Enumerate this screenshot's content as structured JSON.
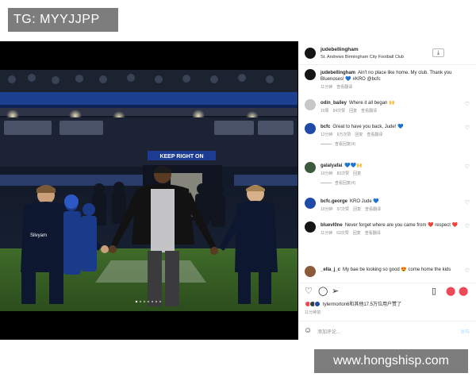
{
  "tag": {
    "text": "TG: MYYJJPP"
  },
  "header": {
    "username": "judebellingham",
    "location": "St. Andrews Birmingham City Football Club",
    "more_icon": "download-box-icon"
  },
  "comments": [
    {
      "user": "judebellingham",
      "text": "Ain't no place like home. My club. Thank you Bluenoses! 💙 #KRO @bcfc",
      "time": "11分钟",
      "translate": "查看翻译",
      "likes": "",
      "reply": "",
      "avatar_color": "#2a2a2a"
    },
    {
      "user": "odin_bailey",
      "text": "Where it all began 🙌",
      "time": "10周",
      "likes": "84次赞",
      "reply": "回复",
      "translate": "查看翻译",
      "avatar_color": "#c7c7c7"
    },
    {
      "user": "bcfc",
      "text": "Great to have you back, Jude! 💙",
      "time": "12分钟",
      "likes": "9万次赞",
      "reply": "回复",
      "translate": "查看翻译",
      "replies": "查看回复(4)",
      "avatar_color": "#1f4aa8"
    },
    {
      "user": "galalyafai",
      "text": "💙💙🙌",
      "time": "10分钟",
      "likes": "83次赞",
      "reply": "回复",
      "translate": "",
      "replies": "查看回复(4)",
      "avatar_color": "#3d5a3d"
    },
    {
      "user": "bcfc.george",
      "text": "KRO Jude 💙",
      "time": "10分钟",
      "likes": "97次赞",
      "reply": "回复",
      "translate": "查看翻译",
      "avatar_color": "#1f4aa8"
    },
    {
      "user": "bluevl0ne",
      "text": "Never forget where are you came from ❤️ respect ❤️",
      "time": "11分钟",
      "likes": "63次赞",
      "reply": "回复",
      "translate": "查看翻译",
      "avatar_color": "#151515"
    },
    {
      "user": "_ella_j_c",
      "text": "My bae be looking so good 😍 come home the kids",
      "time": "",
      "likes": "",
      "reply": "",
      "translate": "",
      "avatar_color": "#8a5a3a"
    }
  ],
  "actions": {
    "like_icon": "heart-icon",
    "comment_icon": "comment-icon",
    "share_icon": "send-icon",
    "save_icon": "bookmark-icon"
  },
  "likes_summary": "tylermorton6和其他17.5万位用户赞了",
  "post_time": "11分钟前",
  "add_comment": {
    "placeholder": "添加评论...",
    "post_label": "发布"
  },
  "photo": {
    "stadium_sign": "KEEP RIGHT ON",
    "kid_kit_sponsor": "Silvyam"
  },
  "watermark": {
    "text": "www.hongshisp.com"
  },
  "colors": {
    "accent_blue": "#0095f6",
    "brand_blue": "#1f4aa8",
    "heart_red": "#ed4956"
  }
}
